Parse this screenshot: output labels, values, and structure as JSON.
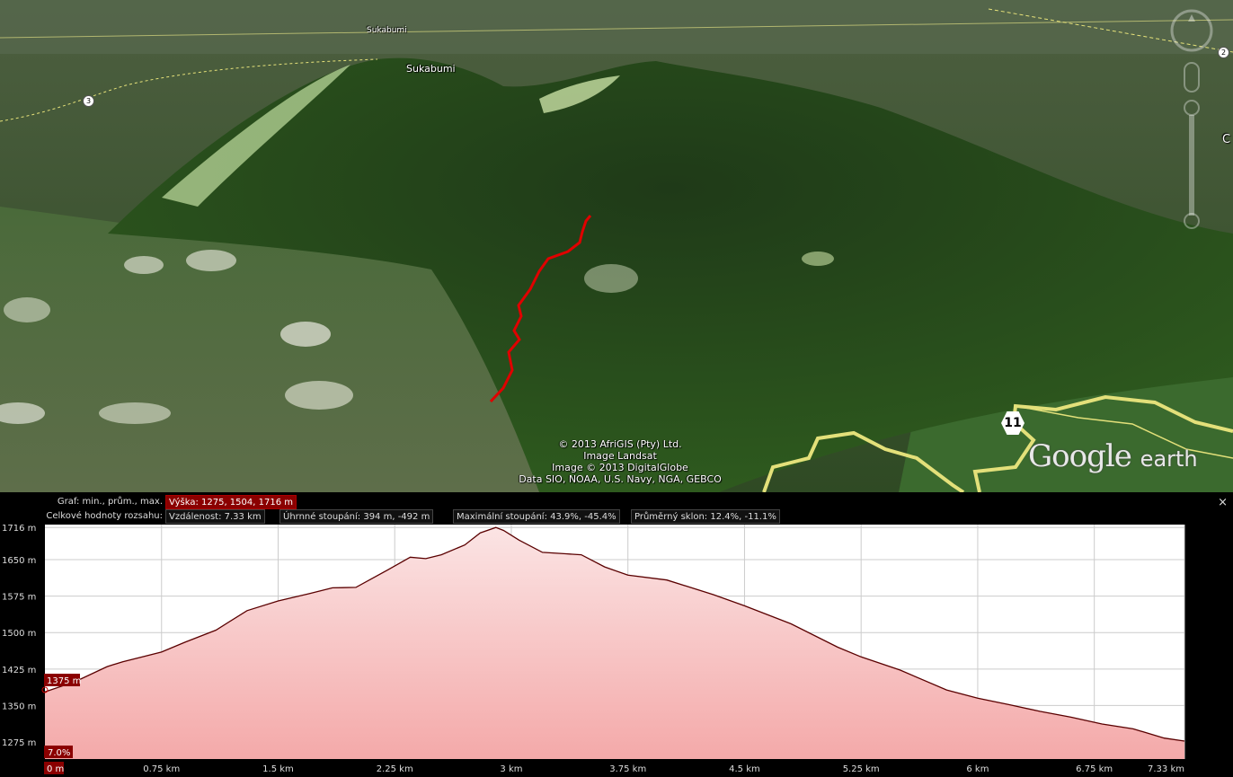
{
  "map": {
    "place_labels": [
      {
        "name": "Sukabumi"
      },
      {
        "name": "Sukabumi"
      },
      {
        "name": "C"
      }
    ],
    "road_shields": [
      "3",
      "2"
    ],
    "highway_shield": "11",
    "credits": [
      "© 2013 AfriGIS (Pty) Ltd.",
      "Image Landsat",
      "Image © 2013 DigitalGlobe",
      "Data SIO, NOAA, U.S. Navy, NGA, GEBCO"
    ],
    "logo": {
      "google": "Google",
      "earth": "earth"
    }
  },
  "panel": {
    "graph_label": "Graf: min., prům., max.",
    "height_value": "Výška: 1275, 1504, 1716 m",
    "range_label": "Celkové hodnoty rozsahu:",
    "distance": "Vzdálenost: 7.33 km",
    "total_climb": "Úhrnné stoupání: 394 m, -492 m",
    "max_climb": "Maximální stoupání: 43.9%, -45.4%",
    "avg_slope": "Průměrný sklon: 12.4%, -11.1%",
    "close_label": "×",
    "cursor_height": "1375 m",
    "cursor_slope": "7.0%",
    "cursor_distance": "0 m"
  },
  "chart_data": {
    "type": "area",
    "x_unit": "km",
    "y_unit": "m",
    "xlim": [
      0,
      7.33
    ],
    "ylim": [
      1240,
      1722
    ],
    "y_ticks": [
      {
        "value": 1716,
        "label": "1716 m"
      },
      {
        "value": 1650,
        "label": "1650 m"
      },
      {
        "value": 1575,
        "label": "1575 m"
      },
      {
        "value": 1500,
        "label": "1500 m"
      },
      {
        "value": 1425,
        "label": "1425 m"
      },
      {
        "value": 1350,
        "label": "1350 m"
      },
      {
        "value": 1275,
        "label": "1275 m"
      }
    ],
    "x_ticks": [
      {
        "value": 0.75,
        "label": "0.75 km"
      },
      {
        "value": 1.5,
        "label": "1.5 km"
      },
      {
        "value": 2.25,
        "label": "2.25 km"
      },
      {
        "value": 3,
        "label": "3 km"
      },
      {
        "value": 3.75,
        "label": "3.75 km"
      },
      {
        "value": 4.5,
        "label": "4.5 km"
      },
      {
        "value": 5.25,
        "label": "5.25 km"
      },
      {
        "value": 6,
        "label": "6 km"
      },
      {
        "value": 6.75,
        "label": "6.75 km"
      },
      {
        "value": 7.33,
        "label": "7.33 km"
      }
    ],
    "x": [
      0,
      0.2,
      0.4,
      0.5,
      0.65,
      0.75,
      0.9,
      1.1,
      1.3,
      1.5,
      1.7,
      1.85,
      2.0,
      2.2,
      2.35,
      2.45,
      2.55,
      2.7,
      2.8,
      2.9,
      2.95,
      3.05,
      3.2,
      3.35,
      3.45,
      3.6,
      3.75,
      4.0,
      4.3,
      4.5,
      4.8,
      5.1,
      5.25,
      5.5,
      5.8,
      6.0,
      6.2,
      6.4,
      6.6,
      6.8,
      7.0,
      7.2,
      7.33
    ],
    "y": [
      1378,
      1400,
      1430,
      1440,
      1452,
      1460,
      1480,
      1505,
      1545,
      1565,
      1580,
      1592,
      1593,
      1628,
      1655,
      1652,
      1660,
      1680,
      1705,
      1716,
      1710,
      1690,
      1665,
      1662,
      1660,
      1635,
      1618,
      1608,
      1578,
      1555,
      1518,
      1470,
      1450,
      1423,
      1382,
      1365,
      1352,
      1338,
      1326,
      1312,
      1302,
      1283,
      1277
    ],
    "grid": true
  }
}
